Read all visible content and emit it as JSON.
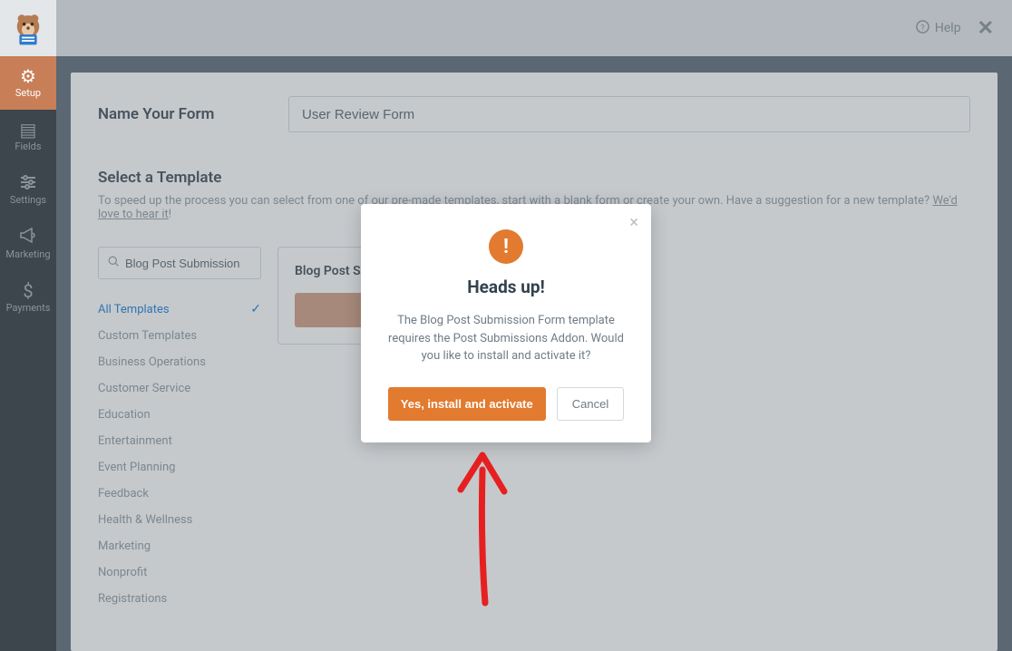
{
  "topbar": {
    "help_label": "Help"
  },
  "sidebar": {
    "items": [
      {
        "label": "Setup",
        "icon": "gear"
      },
      {
        "label": "Fields",
        "icon": "list"
      },
      {
        "label": "Settings",
        "icon": "sliders"
      },
      {
        "label": "Marketing",
        "icon": "megaphone"
      },
      {
        "label": "Payments",
        "icon": "dollar"
      }
    ]
  },
  "form": {
    "name_label": "Name Your Form",
    "name_value": "User Review Form"
  },
  "templates": {
    "heading": "Select a Template",
    "description_prefix": "To speed up the process you can select from one of our pre-made templates, start with a blank form or create your own. Have a suggestion for a new template? ",
    "description_link": "We'd love to hear it",
    "description_suffix": "!",
    "search_value": "Blog Post Submission",
    "categories": [
      "All Templates",
      "Custom Templates",
      "Business Operations",
      "Customer Service",
      "Education",
      "Entertainment",
      "Event Planning",
      "Feedback",
      "Health & Wellness",
      "Marketing",
      "Nonprofit",
      "Registrations"
    ],
    "active_index": 0,
    "card_title": "Blog Post Submission Form"
  },
  "modal": {
    "title": "Heads up!",
    "text": "The Blog Post Submission Form template requires the Post Submissions Addon. Would you like to install and activate it?",
    "confirm": "Yes, install and activate",
    "cancel": "Cancel"
  }
}
